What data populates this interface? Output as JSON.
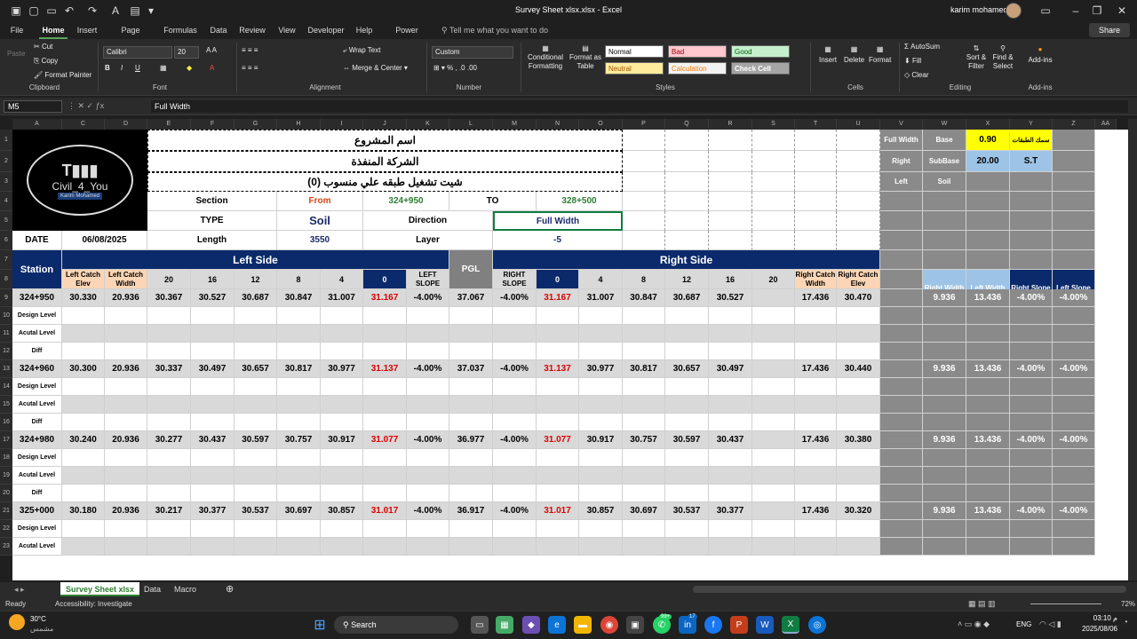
{
  "window": {
    "title": "Survey Sheet xlsx.xlsx  -  Excel",
    "user": "karim mohamed"
  },
  "tabs": [
    "File",
    "Home",
    "Insert",
    "Page Layout",
    "Formulas",
    "Data",
    "Review",
    "Developer",
    "Help",
    "Power Pivot"
  ],
  "tell_me": "Tell me what you want to do",
  "share": "Share",
  "ribbon": {
    "cut": "Cut",
    "copy": "Copy",
    "format_painter": "Format Painter",
    "paste": "Paste",
    "font_name": "Calibri",
    "font_size": "20",
    "wrap_text": "Wrap Text",
    "merge_center": "Merge & Center",
    "number_format": "Custom",
    "conditional": "Conditional Formatting",
    "format_table": "Format as Table",
    "styles": {
      "normal": "Normal",
      "bad": "Bad",
      "good": "Good",
      "neutral": "Neutral",
      "calculation": "Calculation",
      "check": "Check Cell"
    },
    "insert": "Insert",
    "delete": "Delete",
    "format": "Format",
    "autosum": "AutoSum",
    "fill": "Fill",
    "clear": "Clear",
    "sort": "Sort & Filter",
    "find": "Find & Select",
    "addins": "Add-ins",
    "groups": {
      "clipboard": "Clipboard",
      "font": "Font",
      "alignment": "Alignment",
      "number": "Number",
      "styles": "Styles",
      "cells": "Cells",
      "editing": "Editing",
      "addins": "Add-ins"
    }
  },
  "formula_bar": {
    "name_box": "M5",
    "content": "Full Width"
  },
  "columns": [
    "A",
    "C",
    "D",
    "E",
    "F",
    "G",
    "H",
    "I",
    "J",
    "K",
    "L",
    "M",
    "N",
    "O",
    "P",
    "Q",
    "R",
    "S",
    "T",
    "U",
    "V",
    "W",
    "X",
    "Y",
    "Z",
    "AA"
  ],
  "rows": [
    "1",
    "2",
    "3",
    "4",
    "5",
    "6",
    "7",
    "8",
    "9",
    "10",
    "11",
    "12",
    "13",
    "14",
    "15",
    "16",
    "17",
    "18",
    "19",
    "20",
    "21",
    "22",
    "23"
  ],
  "header": {
    "logo_text": "Civil_4_You",
    "logo_sub": "Karim Mohamed",
    "project": "اسم المشروع",
    "contractor": "الشركة المنفذة",
    "sheet_title": "شيت تشغيل طبقه علي منسوب (0)",
    "section": "Section",
    "from": "From",
    "from_val": "324+950",
    "to": "TO",
    "to_val": "328+500",
    "type": "TYPE",
    "type_val": "Soil",
    "direction": "Direction",
    "direction_val": "Full Width",
    "date": "DATE",
    "date_val": "06/08/2025",
    "length": "Length",
    "length_val": "3550",
    "layer": "Layer",
    "layer_val": "-5"
  },
  "side_table": {
    "r1": [
      "Full Width",
      "Base",
      "0.90",
      "سمك الطبقات"
    ],
    "r2": [
      "Right",
      "SubBase",
      "20.00",
      "S.T"
    ],
    "r3": [
      "Left",
      "Soil"
    ],
    "heads": [
      "Right Width",
      "Left Width",
      "Right Slope",
      "Left Slope"
    ]
  },
  "table": {
    "left_side": "Left Side",
    "right_side": "Right Side",
    "station": "Station",
    "pgl": "PGL",
    "cols": [
      "Left Catch Elev",
      "Left Catch Width",
      "20",
      "16",
      "12",
      "8",
      "4",
      "0",
      "LEFT SLOPE",
      "",
      "RIGHT SLOPE",
      "0",
      "4",
      "8",
      "12",
      "16",
      "20",
      "Right Catch Width",
      "Right Catch Elev"
    ],
    "sub_rows": [
      "Design Level",
      "Acutal Level",
      "Diff"
    ],
    "stations": [
      {
        "st": "324+950",
        "vals": [
          "30.330",
          "20.936",
          "30.367",
          "30.527",
          "30.687",
          "30.847",
          "31.007",
          "31.167",
          "-4.00%",
          "37.067",
          "-4.00%",
          "31.167",
          "31.007",
          "30.847",
          "30.687",
          "30.527",
          "",
          "17.436",
          "30.470"
        ],
        "side": [
          "9.936",
          "13.436",
          "-4.00%",
          "-4.00%"
        ]
      },
      {
        "st": "324+960",
        "vals": [
          "30.300",
          "20.936",
          "30.337",
          "30.497",
          "30.657",
          "30.817",
          "30.977",
          "31.137",
          "-4.00%",
          "37.037",
          "-4.00%",
          "31.137",
          "30.977",
          "30.817",
          "30.657",
          "30.497",
          "",
          "17.436",
          "30.440"
        ],
        "side": [
          "9.936",
          "13.436",
          "-4.00%",
          "-4.00%"
        ]
      },
      {
        "st": "324+980",
        "vals": [
          "30.240",
          "20.936",
          "30.277",
          "30.437",
          "30.597",
          "30.757",
          "30.917",
          "31.077",
          "-4.00%",
          "36.977",
          "-4.00%",
          "31.077",
          "30.917",
          "30.757",
          "30.597",
          "30.437",
          "",
          "17.436",
          "30.380"
        ],
        "side": [
          "9.936",
          "13.436",
          "-4.00%",
          "-4.00%"
        ]
      },
      {
        "st": "325+000",
        "vals": [
          "30.180",
          "20.936",
          "30.217",
          "30.377",
          "30.537",
          "30.697",
          "30.857",
          "31.017",
          "-4.00%",
          "36.917",
          "-4.00%",
          "31.017",
          "30.857",
          "30.697",
          "30.537",
          "30.377",
          "",
          "17.436",
          "30.320"
        ],
        "side": [
          "9.936",
          "13.436",
          "-4.00%",
          "-4.00%"
        ]
      }
    ]
  },
  "sheet_tabs": [
    "Survey Sheet xlsx",
    "Data",
    "Macro"
  ],
  "status": {
    "ready": "Ready",
    "accessibility": "Accessibility: Investigate",
    "zoom": "72%"
  },
  "taskbar": {
    "weather_temp": "30°C",
    "weather_desc": "مشمس",
    "search": "Search",
    "lang": "ENG",
    "time": "03:10 م",
    "date": "2025/08/06",
    "badge1": "99+",
    "badge2": "17"
  }
}
